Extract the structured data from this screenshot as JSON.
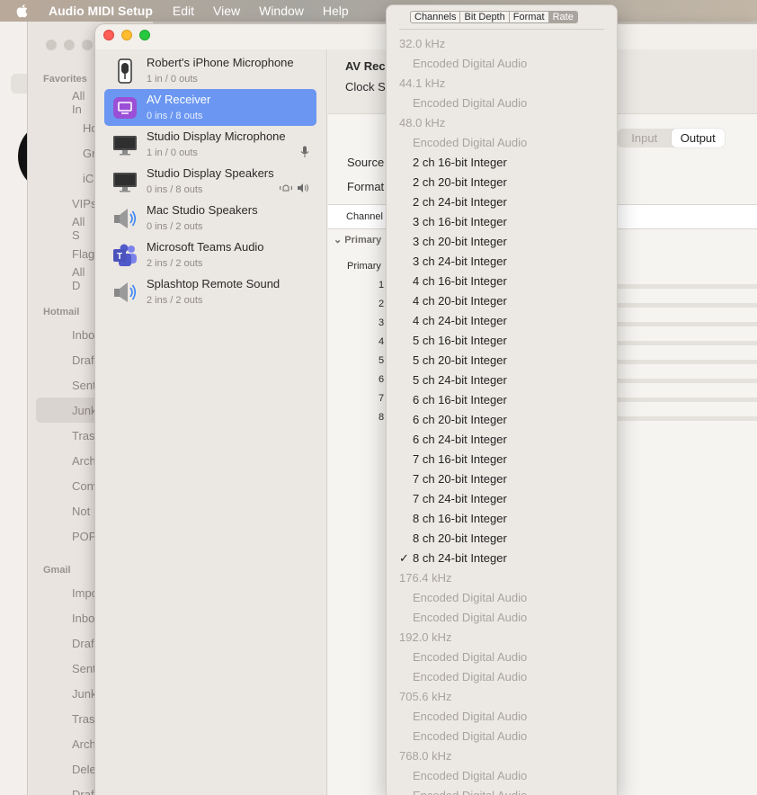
{
  "menubar": {
    "items": [
      "Audio MIDI Setup",
      "Edit",
      "View",
      "Window",
      "Help"
    ]
  },
  "mail": {
    "sections": [
      "Favorites",
      "Hotmail",
      "Gmail"
    ],
    "favorites": [
      "All In",
      "Ho",
      "Gr",
      "iC",
      "VIPs",
      "All S",
      "Flag",
      "All D"
    ],
    "hotmail": [
      "Inbo",
      "Draf",
      "Sent",
      "Junk",
      "Tras",
      "Arch",
      "Conv",
      "Not",
      "POP"
    ],
    "gmail": [
      "Impo",
      "Inbo",
      "Draf",
      "Sent",
      "Junk",
      "Tras",
      "Arch",
      "Dele",
      "Draf"
    ]
  },
  "devices": [
    {
      "name": "Robert's iPhone Microphone",
      "sub": "1 in / 0 outs",
      "icon": "iphone-microphone-icon"
    },
    {
      "name": "AV Receiver",
      "sub": "0 ins / 8 outs",
      "icon": "av-receiver-icon"
    },
    {
      "name": "Studio Display Microphone",
      "sub": "1 in / 0 outs",
      "icon": "display-icon"
    },
    {
      "name": "Studio Display Speakers",
      "sub": "0 ins / 8 outs",
      "icon": "display-icon"
    },
    {
      "name": "Mac Studio Speakers",
      "sub": "0 ins / 2 outs",
      "icon": "speaker-icon"
    },
    {
      "name": "Microsoft Teams Audio",
      "sub": "2 ins / 2 outs",
      "icon": "teams-icon"
    },
    {
      "name": "Splashtop Remote Sound",
      "sub": "2 ins / 2 outs",
      "icon": "speaker-icon"
    }
  ],
  "detail": {
    "title": "AV Rec",
    "clock": "Clock S",
    "source": "Source",
    "format": "Format",
    "channel": "Channel",
    "primary_group": "Primary",
    "primary_row": "Primary",
    "segment": {
      "input": "Input",
      "output": "Output"
    },
    "channels": [
      "1",
      "2",
      "3",
      "4",
      "5",
      "6",
      "7",
      "8"
    ]
  },
  "popup": {
    "tabs": [
      "Channels",
      "Bit Depth",
      "Format",
      "Rate"
    ],
    "active_tab": "Rate",
    "items": [
      {
        "text": "32.0 kHz",
        "kind": "hd"
      },
      {
        "text": "Encoded Digital Audio",
        "kind": "dis"
      },
      {
        "text": "44.1 kHz",
        "kind": "hd"
      },
      {
        "text": "Encoded Digital Audio",
        "kind": "dis"
      },
      {
        "text": "48.0 kHz",
        "kind": "hd"
      },
      {
        "text": "Encoded Digital Audio",
        "kind": "dis"
      },
      {
        "text": "2 ch 16-bit Integer",
        "kind": "en"
      },
      {
        "text": "2 ch 20-bit Integer",
        "kind": "en"
      },
      {
        "text": "2 ch 24-bit Integer",
        "kind": "en"
      },
      {
        "text": "3 ch 16-bit Integer",
        "kind": "en"
      },
      {
        "text": "3 ch 20-bit Integer",
        "kind": "en"
      },
      {
        "text": "3 ch 24-bit Integer",
        "kind": "en"
      },
      {
        "text": "4 ch 16-bit Integer",
        "kind": "en"
      },
      {
        "text": "4 ch 20-bit Integer",
        "kind": "en"
      },
      {
        "text": "4 ch 24-bit Integer",
        "kind": "en"
      },
      {
        "text": "5 ch 16-bit Integer",
        "kind": "en"
      },
      {
        "text": "5 ch 20-bit Integer",
        "kind": "en"
      },
      {
        "text": "5 ch 24-bit Integer",
        "kind": "en"
      },
      {
        "text": "6 ch 16-bit Integer",
        "kind": "en"
      },
      {
        "text": "6 ch 20-bit Integer",
        "kind": "en"
      },
      {
        "text": "6 ch 24-bit Integer",
        "kind": "en"
      },
      {
        "text": "7 ch 16-bit Integer",
        "kind": "en"
      },
      {
        "text": "7 ch 20-bit Integer",
        "kind": "en"
      },
      {
        "text": "7 ch 24-bit Integer",
        "kind": "en"
      },
      {
        "text": "8 ch 16-bit Integer",
        "kind": "en"
      },
      {
        "text": "8 ch 20-bit Integer",
        "kind": "en"
      },
      {
        "text": "8 ch 24-bit Integer",
        "kind": "en",
        "checked": true
      },
      {
        "text": "176.4 kHz",
        "kind": "hd"
      },
      {
        "text": "Encoded Digital Audio",
        "kind": "dis"
      },
      {
        "text": "Encoded Digital Audio",
        "kind": "dis"
      },
      {
        "text": "192.0 kHz",
        "kind": "hd"
      },
      {
        "text": "Encoded Digital Audio",
        "kind": "dis"
      },
      {
        "text": "Encoded Digital Audio",
        "kind": "dis"
      },
      {
        "text": "705.6 kHz",
        "kind": "hd"
      },
      {
        "text": "Encoded Digital Audio",
        "kind": "dis"
      },
      {
        "text": "Encoded Digital Audio",
        "kind": "dis"
      },
      {
        "text": "768.0 kHz",
        "kind": "hd"
      },
      {
        "text": "Encoded Digital Audio",
        "kind": "dis"
      },
      {
        "text": "Encoded Digital Audio",
        "kind": "dis"
      }
    ],
    "checkmark": "✓"
  },
  "colors": {
    "selection": "#6b97f2",
    "close": "#ff5f57",
    "minimize": "#febc2e",
    "zoom": "#28c840"
  }
}
